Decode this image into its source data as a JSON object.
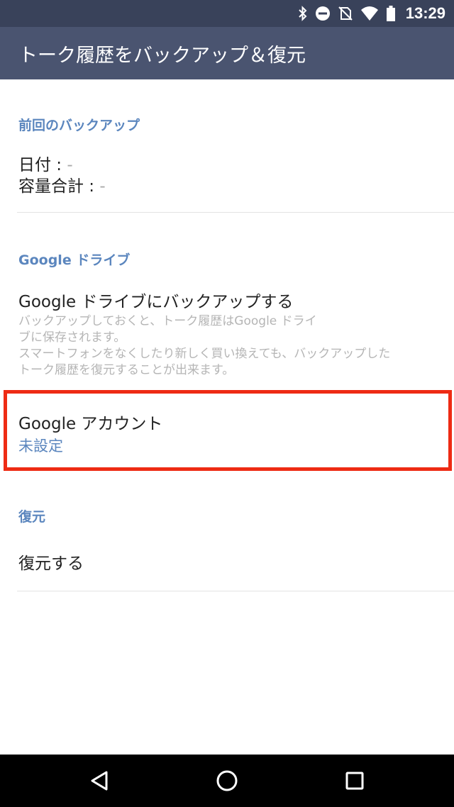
{
  "status_bar": {
    "time": "13:29",
    "icons": [
      "bluetooth-icon",
      "do-not-disturb-icon",
      "no-sim-icon",
      "wifi-icon",
      "battery-icon"
    ]
  },
  "app_bar": {
    "title": "トーク履歴をバックアップ＆復元"
  },
  "last_backup": {
    "header": "前回のバックアップ",
    "date_label": "日付 : ",
    "date_value": "-",
    "size_label": "容量合計 : ",
    "size_value": "-"
  },
  "google_drive": {
    "header": "Google ドライブ",
    "backup_title": "Google ドライブにバックアップする",
    "backup_desc": "バックアップしておくと、トーク履歴はGoogle ドライ\nブに保存されます。\nスマートフォンをなくしたり新しく買い換えても、バックアップした\nトーク履歴を復元することが出来ます。",
    "account_title": "Google アカウント",
    "account_value": "未設定"
  },
  "restore": {
    "header": "復元",
    "restore_title": "復元する"
  },
  "nav_bar": {
    "icons": [
      "back-icon",
      "home-icon",
      "recents-icon"
    ]
  },
  "colors": {
    "status_bar": "#39425a",
    "app_bar": "#4a5470",
    "accent": "#5b86be",
    "highlight": "#ee2b14"
  }
}
